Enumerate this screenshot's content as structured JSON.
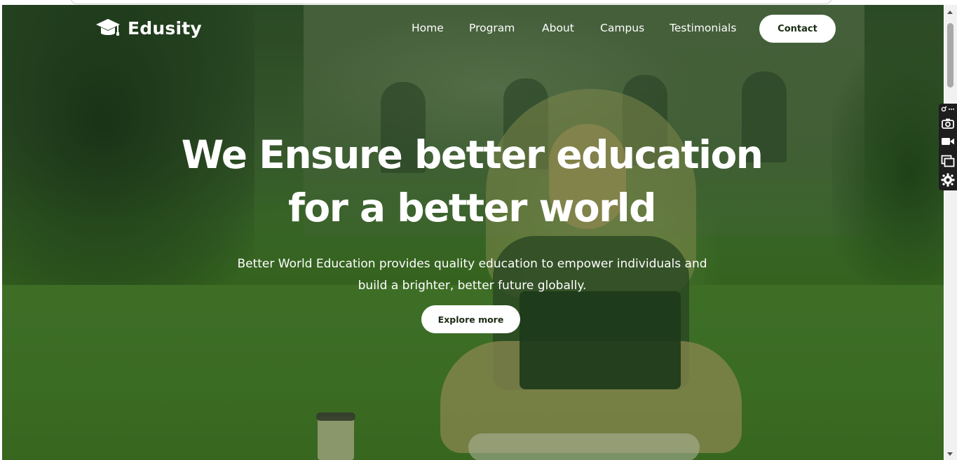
{
  "brand": {
    "name": "Edusity",
    "icon": "graduation-cap-icon"
  },
  "nav": {
    "items": [
      {
        "label": "Home"
      },
      {
        "label": "Program"
      },
      {
        "label": "About"
      },
      {
        "label": "Campus"
      },
      {
        "label": "Testimonials"
      }
    ],
    "contact_label": "Contact"
  },
  "hero": {
    "headline_line1": "We Ensure better education",
    "headline_line2": "for a better world",
    "subtitle_line1": "Better World Education provides quality education to empower individuals and",
    "subtitle_line2": "build a brighter, better future globally.",
    "cta_label": "Explore more"
  },
  "side_toolbar": {
    "icons": [
      "link-icon",
      "more-icon",
      "camera-icon",
      "video-icon",
      "windows-icon",
      "settings-icon"
    ]
  },
  "colors": {
    "overlay_green": "#3b6b1f",
    "button_bg": "#ffffff",
    "button_text": "#1a2b12",
    "text": "#ffffff"
  }
}
